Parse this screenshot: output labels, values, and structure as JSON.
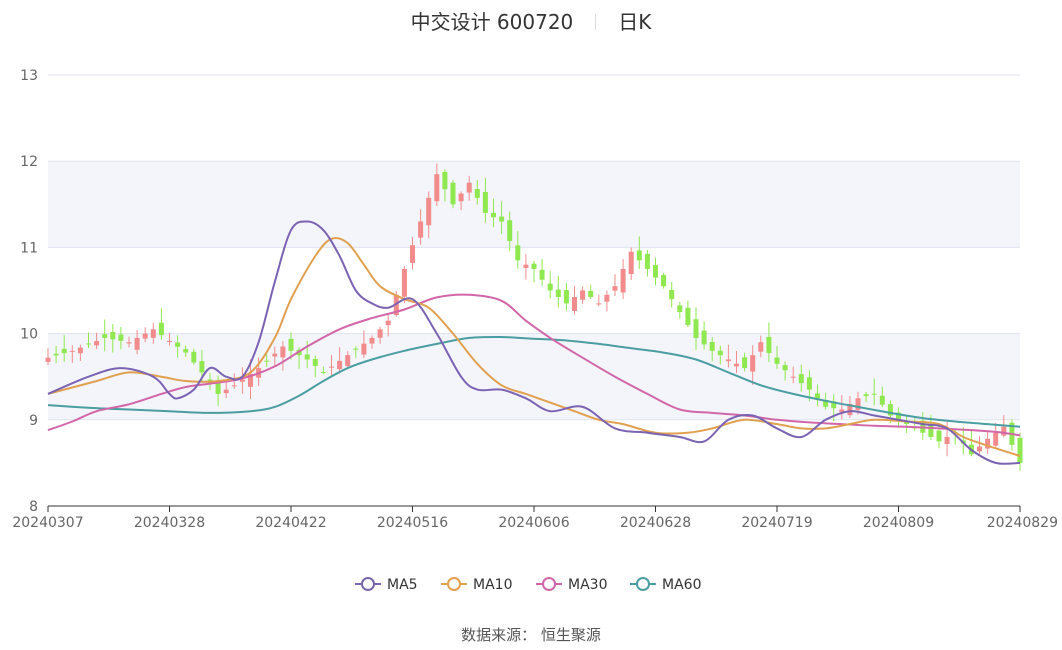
{
  "header": {
    "title": "中交设计 600720",
    "period": "日K"
  },
  "source_label": "数据来源：  恒生聚源",
  "colors": {
    "up": "#f28b8b",
    "down": "#8fe84f",
    "ma5": "#7b63b3",
    "ma10": "#e0a050",
    "ma30": "#d266a8",
    "ma60": "#4a9ea2",
    "band": "#f3f5fb",
    "grid": "#dfe3ee",
    "axis": "#666666"
  },
  "chart_data": {
    "type": "candlestick",
    "ylim": [
      8,
      13
    ],
    "yticks": [
      8,
      9,
      10,
      11,
      12,
      13
    ],
    "x_tick_labels": [
      "20240307",
      "20240328",
      "20240422",
      "20240516",
      "20240606",
      "20240628",
      "20240719",
      "20240809",
      "20240829"
    ],
    "legend": [
      "MA5",
      "MA10",
      "MA30",
      "MA60"
    ],
    "legend_position": "bottom",
    "candle_count": 121,
    "price_path": [
      [
        0,
        9.72
      ],
      [
        3,
        9.8
      ],
      [
        7,
        9.95
      ],
      [
        10,
        9.9
      ],
      [
        13,
        10.05
      ],
      [
        17,
        9.78
      ],
      [
        19,
        9.55
      ],
      [
        21,
        9.3
      ],
      [
        23,
        9.4
      ],
      [
        26,
        9.6
      ],
      [
        29,
        9.85
      ],
      [
        32,
        9.7
      ],
      [
        34,
        9.55
      ],
      [
        37,
        9.75
      ],
      [
        40,
        9.95
      ],
      [
        42,
        10.15
      ],
      [
        44,
        10.75
      ],
      [
        46,
        11.3
      ],
      [
        48,
        11.85
      ],
      [
        50,
        11.5
      ],
      [
        52,
        11.75
      ],
      [
        54,
        11.4
      ],
      [
        56,
        11.3
      ],
      [
        58,
        10.85
      ],
      [
        60,
        10.75
      ],
      [
        62,
        10.5
      ],
      [
        64,
        10.35
      ],
      [
        66,
        10.5
      ],
      [
        68,
        10.35
      ],
      [
        70,
        10.55
      ],
      [
        72,
        10.95
      ],
      [
        74,
        10.75
      ],
      [
        76,
        10.55
      ],
      [
        78,
        10.25
      ],
      [
        80,
        9.95
      ],
      [
        82,
        9.8
      ],
      [
        84,
        9.7
      ],
      [
        86,
        9.6
      ],
      [
        88,
        9.9
      ],
      [
        90,
        9.65
      ],
      [
        92,
        9.5
      ],
      [
        94,
        9.35
      ],
      [
        96,
        9.15
      ],
      [
        98,
        9.12
      ],
      [
        100,
        9.25
      ],
      [
        102,
        9.3
      ],
      [
        104,
        9.05
      ],
      [
        106,
        8.95
      ],
      [
        108,
        8.85
      ],
      [
        110,
        8.75
      ],
      [
        112,
        8.85
      ],
      [
        114,
        8.6
      ],
      [
        116,
        8.78
      ],
      [
        118,
        8.92
      ],
      [
        120,
        8.5
      ]
    ],
    "ma5": [
      [
        0,
        9.3
      ],
      [
        5,
        9.5
      ],
      [
        9,
        9.6
      ],
      [
        13,
        9.5
      ],
      [
        15,
        9.3
      ],
      [
        16,
        9.25
      ],
      [
        18,
        9.35
      ],
      [
        20,
        9.6
      ],
      [
        22,
        9.5
      ],
      [
        24,
        9.5
      ],
      [
        26,
        9.9
      ],
      [
        28,
        10.6
      ],
      [
        30,
        11.2
      ],
      [
        32,
        11.3
      ],
      [
        34,
        11.2
      ],
      [
        36,
        10.9
      ],
      [
        38,
        10.5
      ],
      [
        40,
        10.35
      ],
      [
        42,
        10.3
      ],
      [
        45,
        10.4
      ],
      [
        48,
        10.0
      ],
      [
        51,
        9.5
      ],
      [
        53,
        9.35
      ],
      [
        56,
        9.35
      ],
      [
        59,
        9.25
      ],
      [
        62,
        9.1
      ],
      [
        66,
        9.15
      ],
      [
        70,
        8.9
      ],
      [
        74,
        8.85
      ],
      [
        78,
        8.8
      ],
      [
        81,
        8.75
      ],
      [
        84,
        9.0
      ],
      [
        87,
        9.05
      ],
      [
        90,
        8.9
      ],
      [
        93,
        8.8
      ],
      [
        96,
        9.0
      ],
      [
        99,
        9.1
      ],
      [
        102,
        9.05
      ],
      [
        105,
        9.0
      ],
      [
        108,
        8.95
      ],
      [
        111,
        8.9
      ],
      [
        114,
        8.65
      ],
      [
        117,
        8.5
      ],
      [
        120,
        8.5
      ]
    ],
    "ma10": [
      [
        0,
        9.3
      ],
      [
        6,
        9.45
      ],
      [
        10,
        9.55
      ],
      [
        14,
        9.5
      ],
      [
        17,
        9.45
      ],
      [
        21,
        9.45
      ],
      [
        25,
        9.55
      ],
      [
        28,
        9.95
      ],
      [
        30,
        10.4
      ],
      [
        33,
        10.9
      ],
      [
        35,
        11.1
      ],
      [
        37,
        11.05
      ],
      [
        39,
        10.8
      ],
      [
        41,
        10.55
      ],
      [
        44,
        10.4
      ],
      [
        47,
        10.3
      ],
      [
        50,
        10.0
      ],
      [
        53,
        9.65
      ],
      [
        56,
        9.4
      ],
      [
        59,
        9.3
      ],
      [
        62,
        9.2
      ],
      [
        65,
        9.1
      ],
      [
        68,
        9.0
      ],
      [
        71,
        8.95
      ],
      [
        75,
        8.85
      ],
      [
        79,
        8.85
      ],
      [
        82,
        8.9
      ],
      [
        86,
        9.0
      ],
      [
        90,
        8.95
      ],
      [
        93,
        8.9
      ],
      [
        96,
        8.9
      ],
      [
        99,
        8.95
      ],
      [
        102,
        9.0
      ],
      [
        106,
        8.98
      ],
      [
        110,
        8.95
      ],
      [
        113,
        8.8
      ],
      [
        116,
        8.7
      ],
      [
        120,
        8.58
      ]
    ],
    "ma30": [
      [
        0,
        8.88
      ],
      [
        3,
        8.98
      ],
      [
        6,
        9.1
      ],
      [
        10,
        9.18
      ],
      [
        14,
        9.3
      ],
      [
        17,
        9.38
      ],
      [
        20,
        9.42
      ],
      [
        24,
        9.48
      ],
      [
        28,
        9.62
      ],
      [
        32,
        9.85
      ],
      [
        36,
        10.05
      ],
      [
        40,
        10.18
      ],
      [
        44,
        10.28
      ],
      [
        48,
        10.42
      ],
      [
        52,
        10.45
      ],
      [
        56,
        10.38
      ],
      [
        59,
        10.15
      ],
      [
        62,
        9.95
      ],
      [
        66,
        9.72
      ],
      [
        70,
        9.5
      ],
      [
        74,
        9.3
      ],
      [
        78,
        9.12
      ],
      [
        82,
        9.08
      ],
      [
        86,
        9.05
      ],
      [
        90,
        9.0
      ],
      [
        94,
        8.97
      ],
      [
        98,
        8.95
      ],
      [
        102,
        8.93
      ],
      [
        106,
        8.92
      ],
      [
        110,
        8.9
      ],
      [
        114,
        8.88
      ],
      [
        117,
        8.86
      ],
      [
        120,
        8.82
      ]
    ],
    "ma60": [
      [
        0,
        9.17
      ],
      [
        5,
        9.14
      ],
      [
        10,
        9.12
      ],
      [
        15,
        9.1
      ],
      [
        20,
        9.08
      ],
      [
        25,
        9.1
      ],
      [
        28,
        9.15
      ],
      [
        31,
        9.28
      ],
      [
        34,
        9.45
      ],
      [
        37,
        9.6
      ],
      [
        40,
        9.7
      ],
      [
        44,
        9.8
      ],
      [
        48,
        9.88
      ],
      [
        52,
        9.95
      ],
      [
        56,
        9.96
      ],
      [
        60,
        9.94
      ],
      [
        64,
        9.92
      ],
      [
        68,
        9.88
      ],
      [
        72,
        9.83
      ],
      [
        76,
        9.78
      ],
      [
        80,
        9.7
      ],
      [
        84,
        9.55
      ],
      [
        88,
        9.4
      ],
      [
        92,
        9.3
      ],
      [
        96,
        9.22
      ],
      [
        100,
        9.15
      ],
      [
        104,
        9.08
      ],
      [
        108,
        9.02
      ],
      [
        112,
        8.98
      ],
      [
        116,
        8.95
      ],
      [
        120,
        8.92
      ]
    ]
  }
}
